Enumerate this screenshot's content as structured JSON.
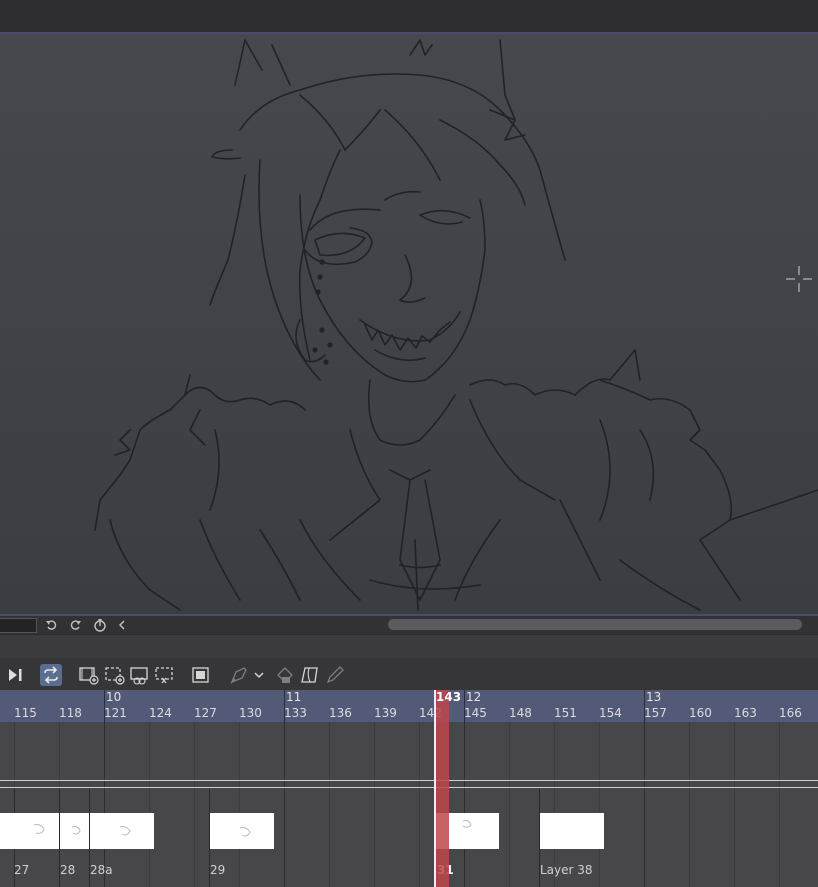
{
  "canvas": {
    "description_icon": "crosshair-cursor-icon"
  },
  "navigator": {
    "icons": [
      "undo-rotate-icon",
      "redo-rotate-icon",
      "reset-rotation-icon",
      "collapse-left-icon"
    ]
  },
  "toolbar": {
    "icons": [
      "play-end-icon",
      "loop-icon",
      "new-animation-cel-icon",
      "new-frame-icon",
      "onion-skin-icon",
      "frame-set-icon",
      "show-cel-icon",
      "drawing-tool-icon",
      "dropdown-chevron-icon",
      "fill-icon",
      "transform-icon",
      "pen-icon"
    ]
  },
  "timeline": {
    "current_frame": "143",
    "sections": [
      {
        "label": "10"
      },
      {
        "label": "11"
      },
      {
        "label": "12"
      },
      {
        "label": "13"
      }
    ],
    "frame_labels": [
      "115",
      "118",
      "121",
      "124",
      "127",
      "130",
      "133",
      "136",
      "139",
      "142",
      "145",
      "148",
      "151",
      "154",
      "157",
      "160",
      "163",
      "166"
    ],
    "cels": [
      {
        "name": "27"
      },
      {
        "name": "28"
      },
      {
        "name": "28a"
      },
      {
        "name": "29"
      },
      {
        "name": "31"
      },
      {
        "name": "Layer 38"
      }
    ],
    "colors": {
      "ruler": "#535a78",
      "playhead": "#be464b",
      "active_button": "#5b6e8f"
    }
  }
}
